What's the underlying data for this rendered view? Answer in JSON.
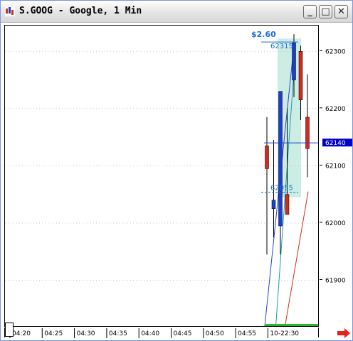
{
  "window": {
    "title": "S.GOOG - Google, 1 Min",
    "minimize_label": "_",
    "maximize_label": "□",
    "close_label": "✕"
  },
  "price_axis": {
    "labels": [
      "62300",
      "62200",
      "62100",
      "62000",
      "61900"
    ],
    "current_price": "62140",
    "current_price_color": "#0000CC"
  },
  "time_axis": {
    "labels": [
      "04:20",
      "04:25",
      "04:30",
      "04:35",
      "04:40",
      "04:45",
      "04:50",
      "04:55",
      "10-22:30"
    ]
  },
  "annotation": {
    "change": "$2.60",
    "high_label": "62315",
    "low_label": "62055",
    "color": "#1E6FD0"
  },
  "chart_data": {
    "type": "candlestick",
    "ylim": [
      61820,
      62345
    ],
    "candles": [
      {
        "open": 62135,
        "high": 62185,
        "low": 61945,
        "close": 62095,
        "color": "red"
      },
      {
        "open": 62025,
        "high": 62145,
        "low": 61975,
        "close": 62040,
        "color": "blue"
      },
      {
        "open": 61995,
        "high": 62095,
        "low": 61945,
        "close": 62230,
        "color": "blue"
      },
      {
        "open": 62050,
        "high": 62200,
        "low": 62025,
        "close": 62015,
        "color": "red"
      },
      {
        "open": 62250,
        "high": 62330,
        "low": 62220,
        "close": 62315,
        "color": "blue"
      },
      {
        "open": 62300,
        "high": 62310,
        "low": 62180,
        "close": 62215,
        "color": "red"
      },
      {
        "open": 62185,
        "high": 62260,
        "low": 62080,
        "close": 62130,
        "color": "red"
      }
    ],
    "colors": {
      "up": "#1A3FD0",
      "down": "#D42A1E"
    }
  }
}
